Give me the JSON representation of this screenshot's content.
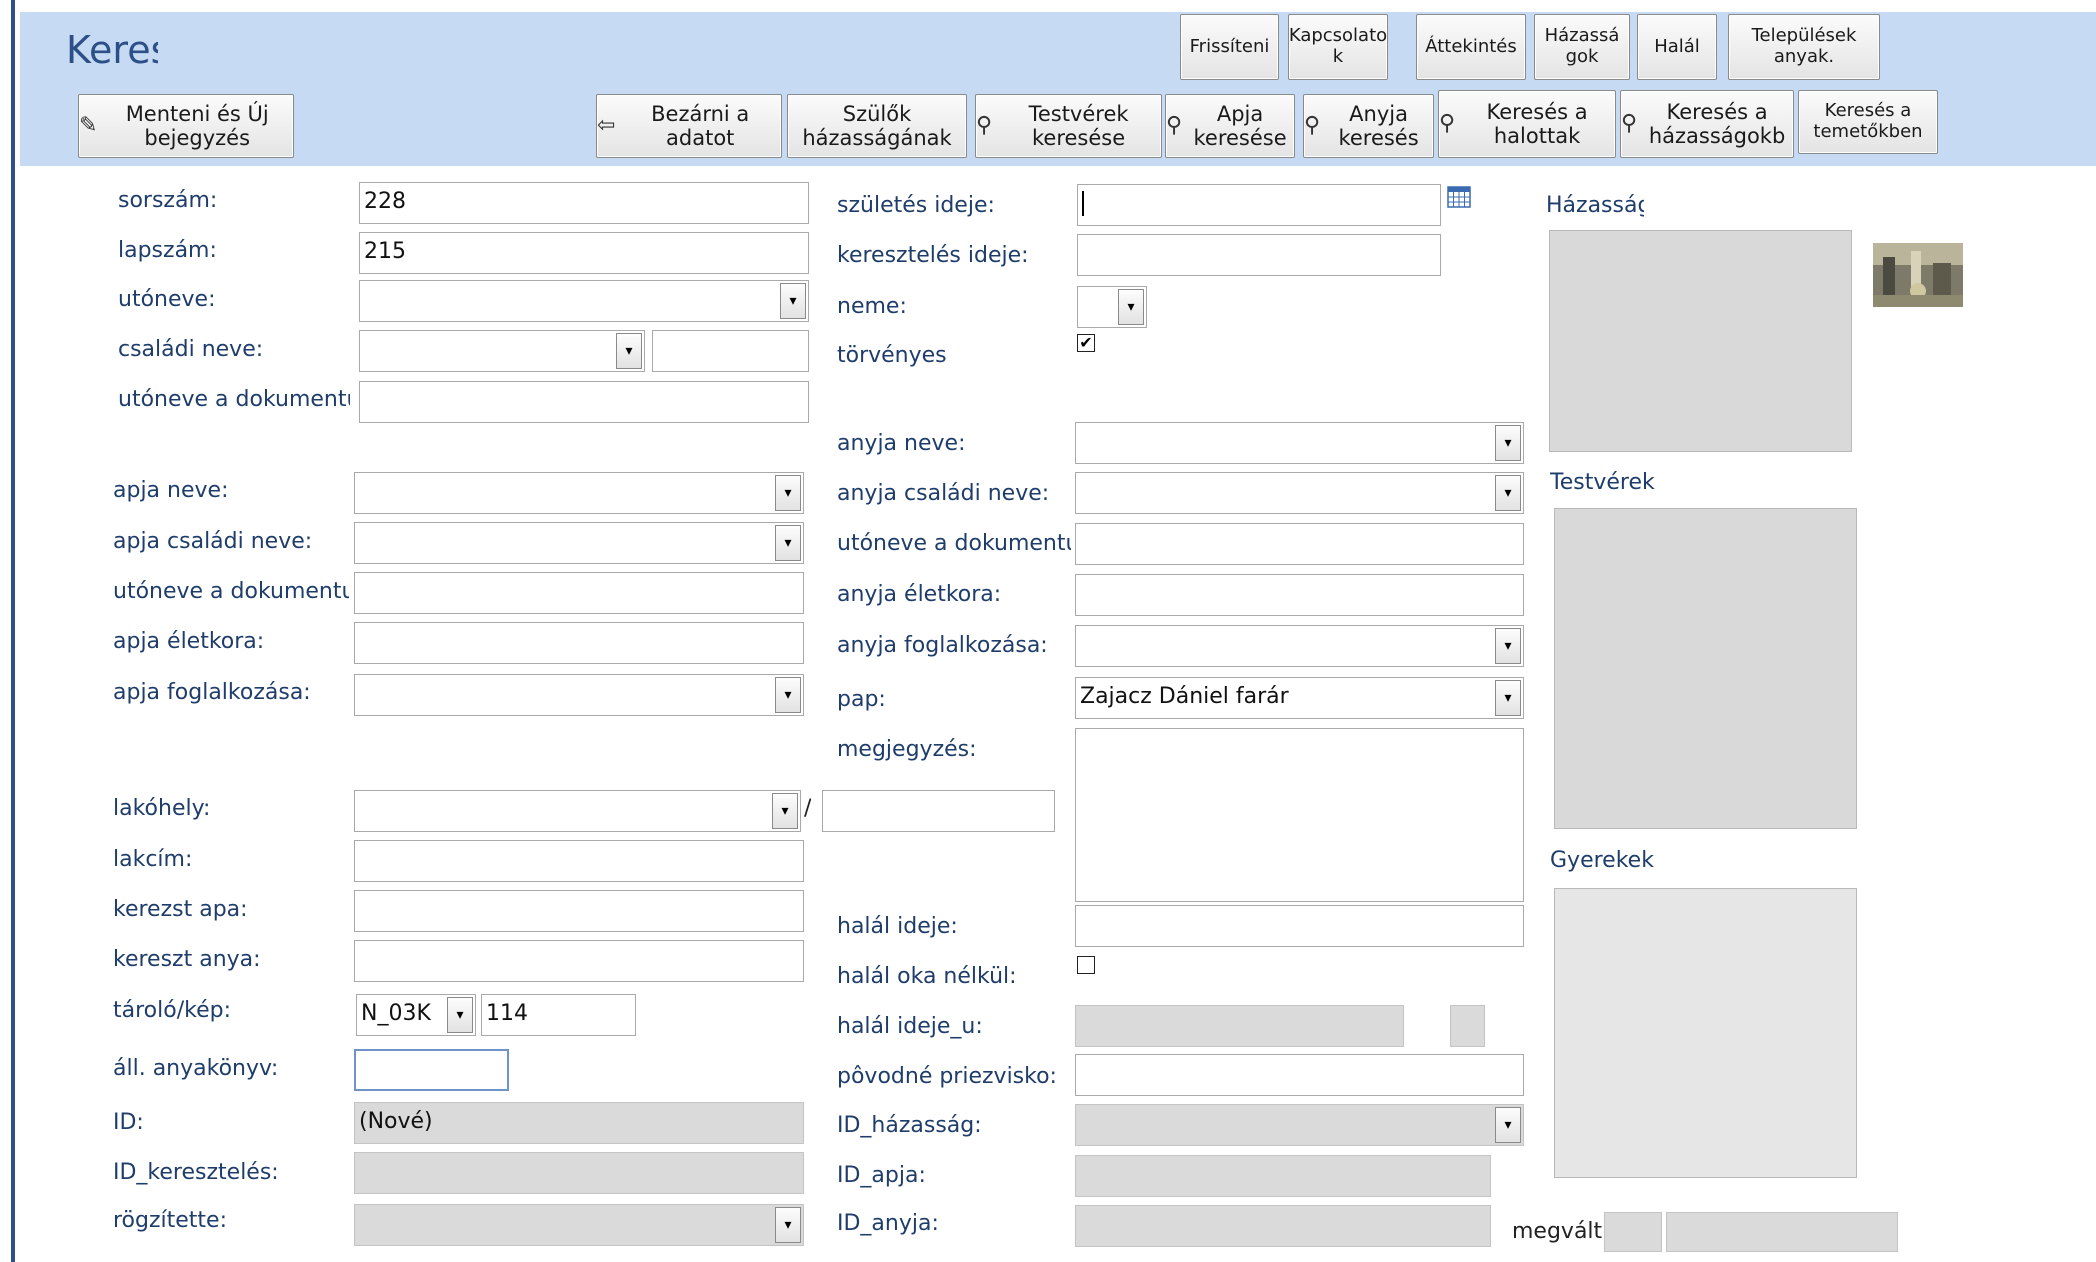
{
  "form": {
    "title": "Keres"
  },
  "top_buttons": [
    {
      "id": "frissiteni",
      "label": "Frissíteni"
    },
    {
      "id": "kapcsolatok",
      "label": "Kapcsolato k"
    },
    {
      "id": "attekintes",
      "label": "Áttekintés"
    },
    {
      "id": "hazassagok",
      "label": "Házassá gok"
    },
    {
      "id": "halal",
      "label": "Halál"
    },
    {
      "id": "telepulesek",
      "label": "Települések anyak."
    }
  ],
  "toolbar": {
    "save_new": "Menteni és Új bejegyzés",
    "close": "Bezárni a adatot",
    "parents_marriage": "Szülők házasságának",
    "siblings_search": "Testvérek keresése",
    "father_search": "Apja keresése",
    "mother_search": "Anyja keresés",
    "search_dead": "Keresés a halottak",
    "search_marriages": "Keresés a házasságokb",
    "search_cemeteries": "Keresés a temetőkben"
  },
  "icons": {
    "save": "save-icon",
    "door": "exit-door-icon",
    "binoculars": "binoculars-icon",
    "calendar": "calendar-icon",
    "dropdown": "chevron-down-icon"
  },
  "left": {
    "sorszam": {
      "label": "sorszám:",
      "value": "228"
    },
    "lapszam": {
      "label": "lapszám:",
      "value": "215"
    },
    "utoneve": {
      "label": "utóneve:",
      "value": ""
    },
    "csaladi_neve": {
      "label": "családi neve:",
      "value": ""
    },
    "utoneve_dok": {
      "label": "utóneve a dokumentu",
      "value": ""
    },
    "apja_neve": {
      "label": "apja neve:",
      "value": ""
    },
    "apja_csaladi": {
      "label": "apja családi neve:",
      "value": ""
    },
    "apja_utoneve_dok": {
      "label": "utóneve a dokumentu",
      "value": ""
    },
    "apja_eletkora": {
      "label": "apja életkora:",
      "value": ""
    },
    "apja_foglalkozasa": {
      "label": "apja foglalkozása:",
      "value": ""
    },
    "lakohely": {
      "label": "lakóhely:",
      "value": "",
      "sep": "/"
    },
    "lakcim": {
      "label": "lakcím:",
      "value": ""
    },
    "kerezst_apa": {
      "label": "kerezst apa:",
      "value": ""
    },
    "kereszt_anya": {
      "label": "kereszt anya:",
      "value": ""
    },
    "tarolo_kep": {
      "label": "tároló/kép:",
      "value": "N_03K",
      "value2": "114"
    },
    "all_anyakonyv": {
      "label": "áll. anyakönyv:",
      "value": ""
    },
    "id": {
      "label": "ID:",
      "value": "(Nové)"
    },
    "id_kereszteles": {
      "label": "ID_keresztelés:",
      "value": ""
    },
    "rogzitette": {
      "label": "rögzítette:",
      "value": ""
    }
  },
  "middle": {
    "szuletes_ideje": {
      "label": "születés ideje:",
      "value": ""
    },
    "kereszteles_ideje": {
      "label": "keresztelés ideje:",
      "value": ""
    },
    "neme": {
      "label": "neme:",
      "value": ""
    },
    "torvenyes": {
      "label": "törvényes",
      "mark": "✔"
    },
    "anyja_neve": {
      "label": "anyja neve:",
      "value": ""
    },
    "anyja_csaladi": {
      "label": "anyja családi neve:",
      "value": ""
    },
    "anyja_utoneve_dok": {
      "label": "utóneve a dokumentu",
      "value": ""
    },
    "anyja_eletkora": {
      "label": "anyja életkora:",
      "value": ""
    },
    "anyja_foglalkozasa": {
      "label": "anyja foglalkozása:",
      "value": ""
    },
    "pap": {
      "label": "pap:",
      "value": "Zajacz Dániel farár"
    },
    "megjegyzes": {
      "label": "megjegyzés:",
      "value": ""
    },
    "halal_ideje": {
      "label": "halál ideje:",
      "value": ""
    },
    "halal_oka_nelkul": {
      "label": "halál oka nélkül:",
      "mark": ""
    },
    "halal_ideje_u": {
      "label": "halál ideje_u:",
      "value": ""
    },
    "povodne_priezvisko": {
      "label": "pôvodné priezvisko:",
      "value": ""
    },
    "id_hazassag": {
      "label": "ID_házasság:",
      "value": ""
    },
    "id_apja": {
      "label": "ID_apja:",
      "value": ""
    },
    "id_anyja": {
      "label": "ID_anyja:",
      "value": ""
    }
  },
  "right": {
    "hazassag": "Házasság",
    "testverek": "Testvérek",
    "gyerekek": "Gyerekek",
    "megvalt": "megvált"
  }
}
